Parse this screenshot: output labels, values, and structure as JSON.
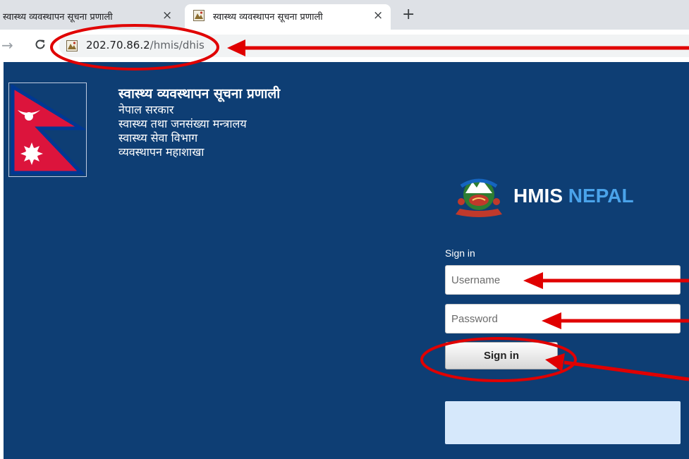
{
  "browser": {
    "tabs": [
      {
        "title": "स्वास्थ्य व्यवस्थापन सूचना प्रणाली",
        "close_glyph": "×",
        "active": false
      },
      {
        "title": "स्वास्थ्य व्यवस्थापन सूचना प्रणाली",
        "close_glyph": "×",
        "active": true
      }
    ],
    "new_tab_glyph": "+",
    "forward_glyph": "→",
    "address": {
      "host": "202.70.86.2",
      "path": "/hmis/dhis"
    },
    "icons": {
      "forward": "arrow-right-icon",
      "reload": "reload-icon",
      "favicon": "hmis-favicon-icon"
    }
  },
  "header": {
    "title": "स्वास्थ्य व्यवस्थापन सूचना प्रणाली",
    "lines": [
      "नेपाल सरकार",
      "स्वास्थ्य तथा जनसंख्या मन्त्रालय",
      "स्वास्थ्य सेवा विभाग",
      "व्यवस्थापन महाशाखा"
    ]
  },
  "brand": {
    "word1": "HMIS",
    "word2": "NEPAL"
  },
  "login": {
    "heading": "Sign in",
    "username_placeholder": "Username",
    "password_placeholder": "Password",
    "submit_label": "Sign in"
  },
  "colors": {
    "page_background": "#0e3e74",
    "brand_accent": "#4aa3ea",
    "flag_red": "#dc143c",
    "flag_blue": "#003893",
    "annotation_red": "#e00000",
    "info_box": "#d6e8fb"
  }
}
